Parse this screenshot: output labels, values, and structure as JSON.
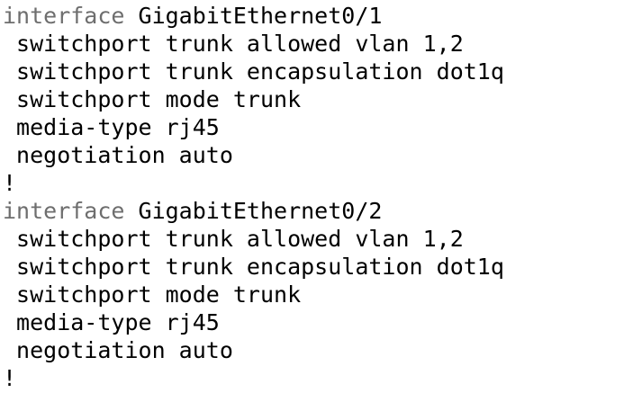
{
  "colors": {
    "text": "#000000",
    "keyword": "#6e6e6e",
    "background": "#ffffff"
  },
  "config": {
    "block1": {
      "interface_keyword": "interface",
      "interface_name": " GigabitEthernet0/1",
      "lines": [
        " switchport trunk allowed vlan 1,2",
        " switchport trunk encapsulation dot1q",
        " switchport mode trunk",
        " media-type rj45",
        " negotiation auto"
      ],
      "terminator": "!"
    },
    "block2": {
      "interface_keyword": "interface",
      "interface_name": " GigabitEthernet0/2",
      "lines": [
        " switchport trunk allowed vlan 1,2",
        " switchport trunk encapsulation dot1q",
        " switchport mode trunk",
        " media-type rj45",
        " negotiation auto"
      ],
      "terminator": "!"
    }
  }
}
